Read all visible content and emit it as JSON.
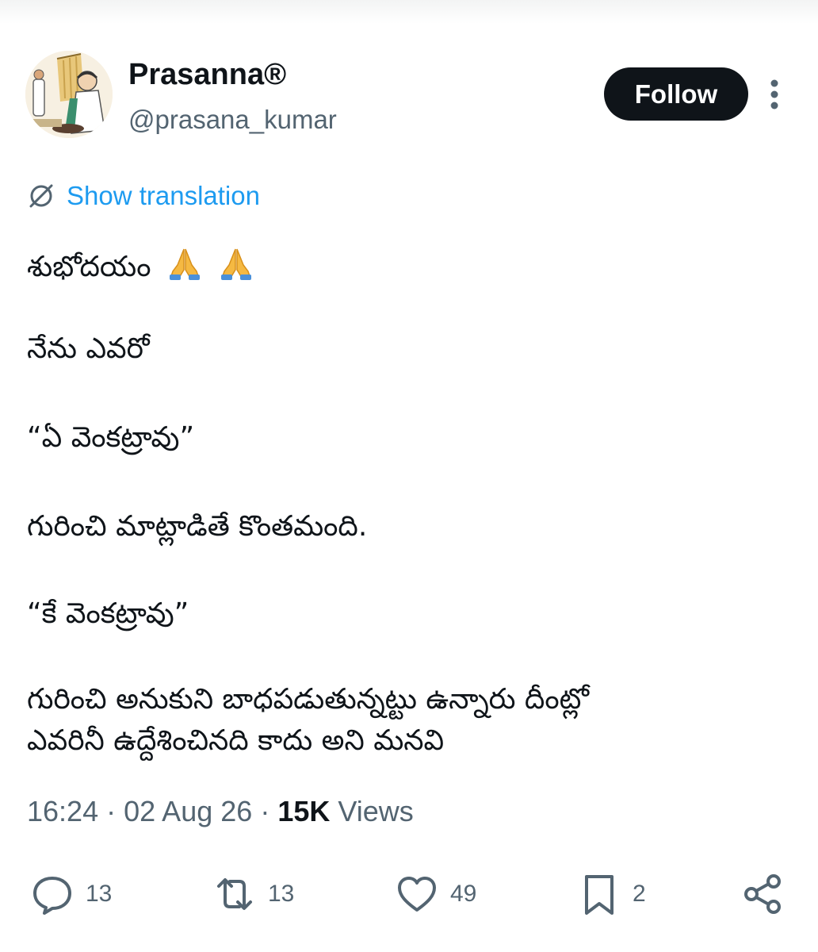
{
  "author": {
    "display_name": "Prasanna®",
    "handle": "@prasana_kumar"
  },
  "follow_label": "Follow",
  "translate": {
    "label": "Show translation",
    "icon": "globe-slash-icon"
  },
  "tweet": {
    "lines": [
      "శుభోదయం",
      "నేను ఎవరో",
      " “ఏ వెంకట్రావు”",
      "గురించి మాట్లాడితే కొంతమంది.",
      "“కే వెంకట్రావు”",
      "గురించి అనుకుని బాధపడుతున్నట్టు ఉన్నారు దీంట్లో",
      "ఎవరినీ ఉద్దేశించినది కాదు అని మనవి"
    ],
    "emoji": [
      "folded-hands-emoji",
      "folded-hands-emoji"
    ]
  },
  "meta": {
    "time": "16:24",
    "date": "02 Aug 26",
    "views_count": "15K",
    "views_label": "Views",
    "separator": "·"
  },
  "actions": {
    "replies": "13",
    "reposts": "13",
    "likes": "49",
    "bookmarks": "2"
  },
  "colors": {
    "text": "#0f1419",
    "secondary": "#536471",
    "link": "#1d9bf0",
    "button": "#0f1419"
  }
}
